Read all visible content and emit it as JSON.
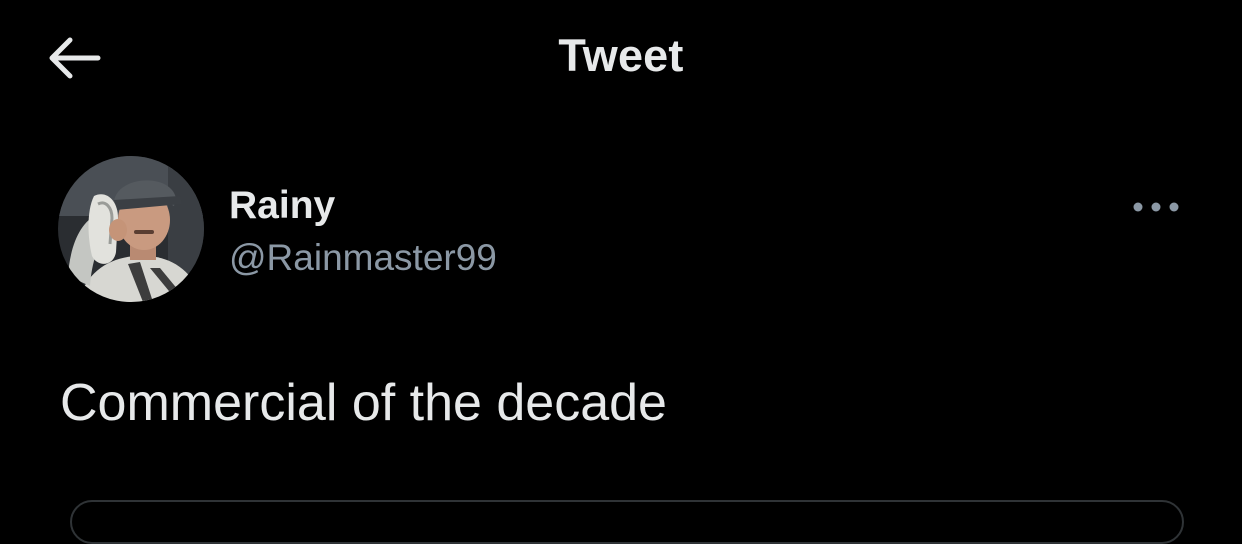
{
  "header": {
    "title": "Tweet",
    "back_icon": "arrow-left-icon"
  },
  "tweet": {
    "author": {
      "display_name": "Rainy",
      "handle": "@Rainmaster99",
      "avatar_icon": "profile-photo"
    },
    "text": "Commercial of the decade",
    "more_icon": "ellipsis-icon"
  },
  "colors": {
    "background": "#000000",
    "primary_text": "#e7e9ea",
    "secondary_text": "#8b98a5",
    "border": "#2f3336"
  }
}
